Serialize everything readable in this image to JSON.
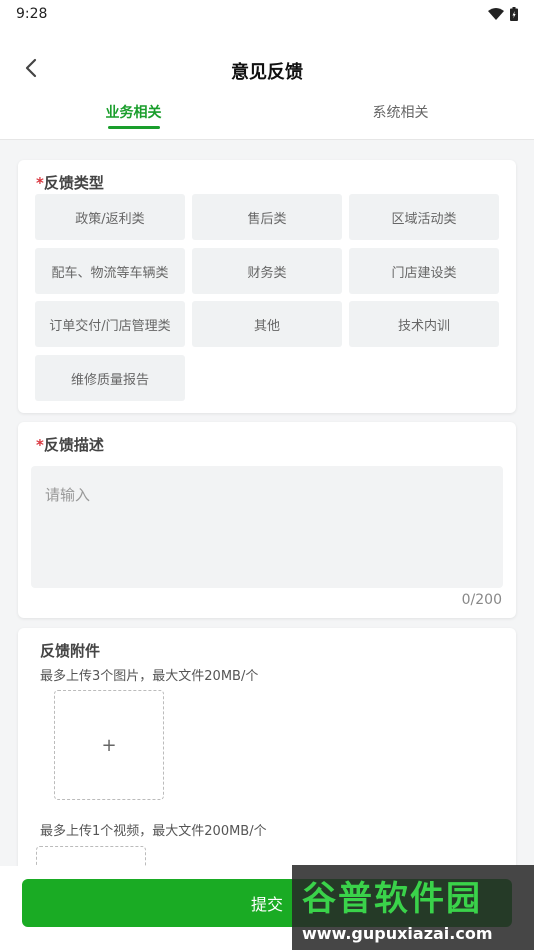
{
  "status_bar": {
    "time": "9:28"
  },
  "header": {
    "title": "意见反馈"
  },
  "tabs": [
    {
      "label": "业务相关",
      "active": true
    },
    {
      "label": "系统相关",
      "active": false
    }
  ],
  "feedback_type": {
    "required_mark": "*",
    "title": "反馈类型",
    "options": [
      "政策/返利类",
      "售后类",
      "区域活动类",
      "配车、物流等车辆类",
      "财务类",
      "门店建设类",
      "订单交付/门店管理类",
      "其他",
      "技术内训",
      "维修质量报告"
    ]
  },
  "description": {
    "required_mark": "*",
    "title": "反馈描述",
    "placeholder": "请输入",
    "counter": "0/200"
  },
  "attachments": {
    "title": "反馈附件",
    "image_hint": "最多上传3个图片，最大文件20MB/个",
    "video_hint": "最多上传1个视频，最大文件200MB/个",
    "add_symbol": "+"
  },
  "footer": {
    "submit_label": "提交"
  },
  "watermark": {
    "main": "谷普软件园",
    "sub": "www.gupuxiazai.com"
  }
}
